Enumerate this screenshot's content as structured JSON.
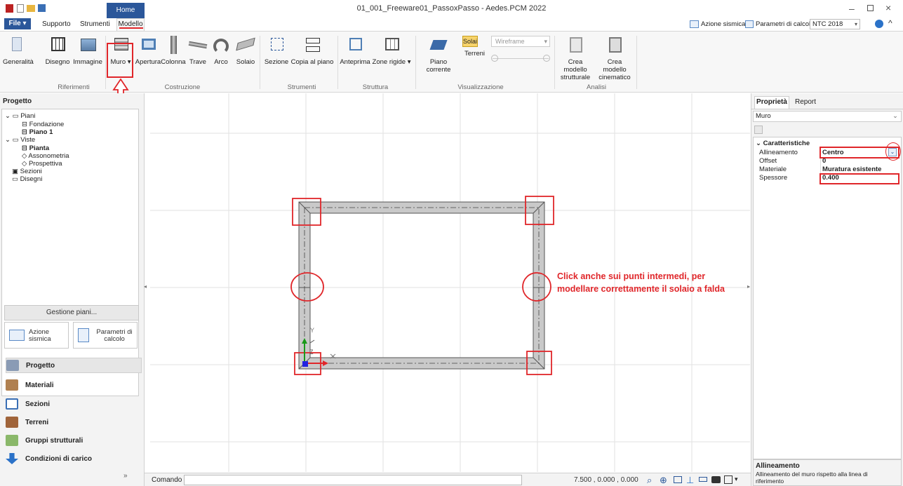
{
  "window": {
    "title": "01_001_Freeware01_PassoxPasso - Aedes.PCM 2022"
  },
  "quick_access": {
    "home_tab": "Home"
  },
  "tabs": [
    {
      "label": "File ▾"
    },
    {
      "label": "Supporto"
    },
    {
      "label": "Strumenti"
    },
    {
      "label": "Modello"
    }
  ],
  "top_right": {
    "azione_sismica": "Azione sismica",
    "parametri": "Parametri di calcolo",
    "norm": "NTC 2018"
  },
  "ribbon": {
    "riferimenti": {
      "label": "Riferimenti",
      "items": [
        "Generalità",
        "Disegno",
        "Immagine"
      ]
    },
    "costruzione": {
      "label": "Costruzione",
      "items": [
        "Muro ▾",
        "Apertura",
        "Colonna",
        "Trave",
        "Arco",
        "Solaio"
      ]
    },
    "strumenti": {
      "label": "Strumenti",
      "items": [
        "Sezione",
        "Copia al piano"
      ]
    },
    "struttura": {
      "label": "Struttura",
      "items": [
        "Anteprima",
        "Zone rigide ▾"
      ]
    },
    "visualizzazione": {
      "label": "Visualizzazione",
      "items": [
        "Piano corrente",
        "Solai",
        "Terreni",
        "Wireframe"
      ]
    },
    "analisi": {
      "label": "Analisi",
      "items": [
        "Crea modello strutturale",
        "Crea modello cinematico"
      ]
    }
  },
  "project": {
    "title": "Progetto",
    "tree": [
      "Piani",
      "Fondazione",
      "Piano 1",
      "Viste",
      "Pianta",
      "Assonometria",
      "Prospettiva",
      "Sezioni",
      "Disegni"
    ],
    "gestione": "Gestione piani...",
    "azione": "Azione sismica",
    "parametri": "Parametri di calcolo",
    "nav": [
      "Progetto",
      "Materiali",
      "Sezioni",
      "Terreni",
      "Gruppi strutturali",
      "Condizioni di carico"
    ]
  },
  "canvas": {
    "annotation": "Click anche sui punti intermedi, per modellare correttamente il solaio a falda",
    "axis_x": "X",
    "axis_y": "Y",
    "axis_z": "Z"
  },
  "statusbar": {
    "command_label": "Comando",
    "coords": "7.500 , 0.000 , 0.000"
  },
  "properties": {
    "tabs": [
      "Proprietà",
      "Report"
    ],
    "object": "Muro",
    "section": "Caratteristiche",
    "rows": [
      {
        "name": "Allineamento",
        "value": "Centro"
      },
      {
        "name": "Offset",
        "value": "0"
      },
      {
        "name": "Materiale",
        "value": "Muratura esistente"
      },
      {
        "name": "Spessore",
        "value": "0.400"
      }
    ],
    "help_title": "Allineamento",
    "help_text": "Allineamento del muro rispetto alla linea di riferimento"
  },
  "colors": {
    "accent": "#2b579a",
    "highlight": "#e0262a"
  }
}
